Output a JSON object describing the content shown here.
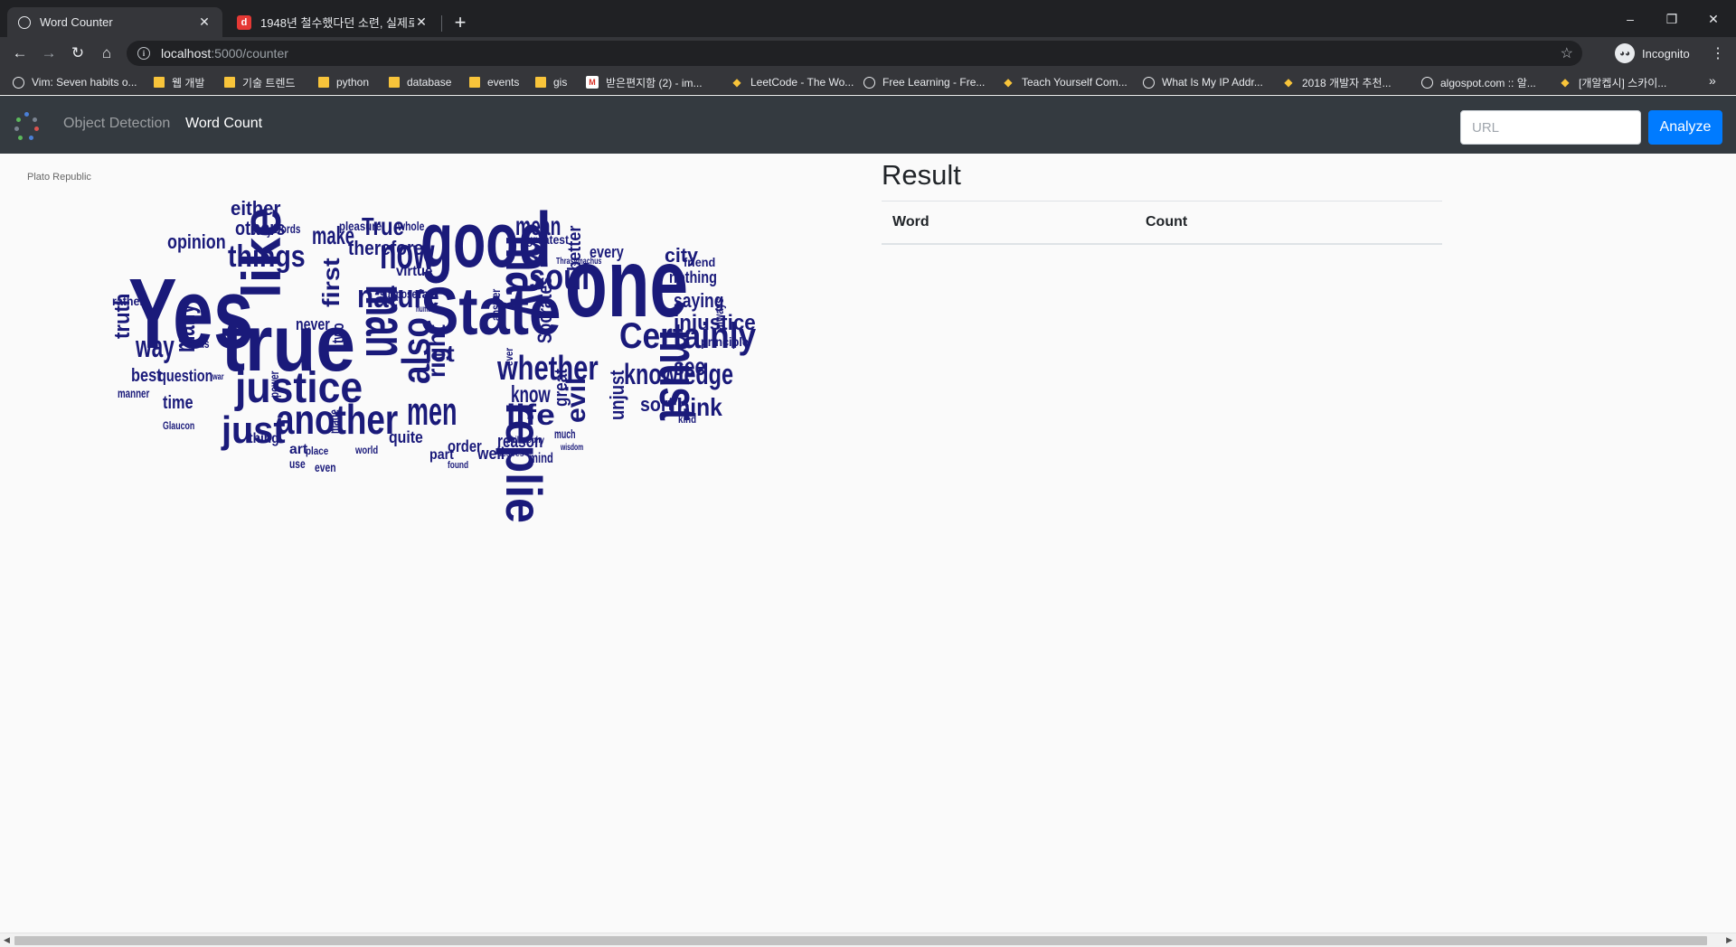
{
  "browser": {
    "tabs": [
      {
        "title": "Word Counter",
        "active": true,
        "favicon": "globe-icon"
      },
      {
        "title": "1948년 철수했다던 소련, 실제로",
        "active": false,
        "favicon": "d"
      }
    ],
    "new_tab": "+",
    "window_controls": {
      "minimize": "–",
      "restore": "❐",
      "close": "✕"
    },
    "address": {
      "host": "localhost",
      "path": ":5000/counter"
    },
    "incognito_label": "Incognito",
    "bookmarks": [
      {
        "label": "Vim: Seven habits o...",
        "icon": "globe"
      },
      {
        "label": "웹 개발",
        "icon": "folder"
      },
      {
        "label": "기술 트렌드",
        "icon": "folder"
      },
      {
        "label": "python",
        "icon": "folder"
      },
      {
        "label": "database",
        "icon": "folder"
      },
      {
        "label": "events",
        "icon": "folder"
      },
      {
        "label": "gis",
        "icon": "folder"
      },
      {
        "label": "받은편지함 (2) - im...",
        "icon": "gmail"
      },
      {
        "label": "LeetCode - The Wo...",
        "icon": "glyph"
      },
      {
        "label": "Free Learning - Fre...",
        "icon": "globe"
      },
      {
        "label": "Teach Yourself Com...",
        "icon": "glyph"
      },
      {
        "label": "What Is My IP Addr...",
        "icon": "globe"
      },
      {
        "label": "2018 개발자 추천...",
        "icon": "glyph"
      },
      {
        "label": "algospot.com :: 알...",
        "icon": "globe"
      },
      {
        "label": "[개알켑시] 스카이...",
        "icon": "glyph"
      }
    ]
  },
  "app": {
    "nav": {
      "link1": "Object Detection",
      "link2": "Word Count"
    },
    "search": {
      "placeholder": "URL"
    },
    "analyze_label": "Analyze"
  },
  "wordcloud": {
    "caption": "Plato Republic",
    "color": "#1a1a7a",
    "words": [
      "Yes",
      "good",
      "one",
      "true",
      "may",
      "State",
      "man",
      "must",
      "like",
      "now",
      "replied",
      "justice",
      "another",
      "Certainly",
      "whether",
      "soul",
      "mean",
      "things",
      "nature",
      "also",
      "just",
      "men",
      "knowledge",
      "life",
      "think",
      "see",
      "injustice",
      "saying",
      "city",
      "make",
      "others",
      "opinion",
      "way",
      "many",
      "either",
      "True",
      "therefore",
      "virtue",
      "let",
      "right",
      "first",
      "know",
      "evil",
      "reason",
      "question",
      "best",
      "time",
      "thing",
      "quite",
      "order",
      "part",
      "well",
      "mind",
      "sort",
      "unjust",
      "great",
      "better",
      "every",
      "Socrates",
      "nothing",
      "friend",
      "principle",
      "always",
      "kind",
      "truth",
      "rather",
      "gods",
      "manner",
      "art",
      "use",
      "even",
      "world",
      "place",
      "Glaucon",
      "never",
      "two",
      "suppose",
      "far",
      "pleasure",
      "whole",
      "body",
      "words",
      "greatest",
      "Thrasymachus",
      "much",
      "wisdom",
      "desires",
      "philosophy",
      "ever",
      "answer",
      "human",
      "power",
      "war",
      "made",
      "found"
    ]
  },
  "result": {
    "title": "Result",
    "columns": [
      "Word",
      "Count"
    ]
  }
}
